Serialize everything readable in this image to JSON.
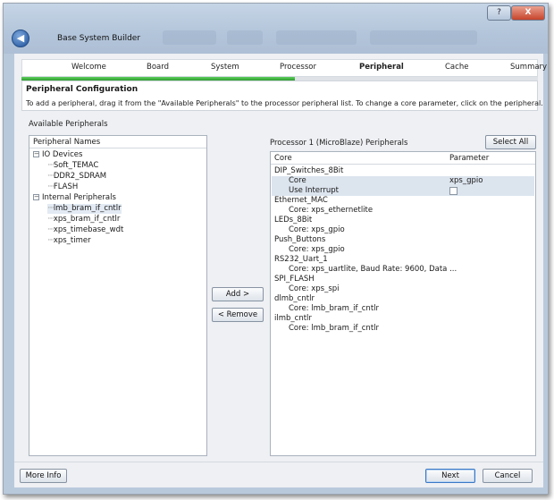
{
  "window": {
    "title": "Base System Builder",
    "help_label": "?",
    "close_label": "X",
    "back_label": "◀"
  },
  "steps": [
    {
      "label": "Welcome"
    },
    {
      "label": "Board"
    },
    {
      "label": "System"
    },
    {
      "label": "Processor"
    },
    {
      "label": "Peripheral"
    },
    {
      "label": "Cache"
    },
    {
      "label": "Summary"
    }
  ],
  "progress_fraction": 0.53,
  "header": {
    "title": "Peripheral Configuration",
    "description": "To add a peripheral, drag it from the \"Available Peripherals\" to the processor peripheral list. To change a core parameter, click on the peripheral."
  },
  "available": {
    "label": "Available Peripherals",
    "column": "Peripheral Names",
    "groups": [
      {
        "name": "IO Devices",
        "items": [
          "Soft_TEMAC",
          "DDR2_SDRAM",
          "FLASH"
        ]
      },
      {
        "name": "Internal Peripherals",
        "items": [
          "lmb_bram_if_cntlr",
          "xps_bram_if_cntlr",
          "xps_timebase_wdt",
          "xps_timer"
        ]
      }
    ]
  },
  "buttons": {
    "add": "Add >",
    "remove": "< Remove",
    "select_all": "Select All",
    "more_info": "More Info",
    "next": "Next",
    "cancel": "Cancel"
  },
  "processor": {
    "label": "Processor 1 (MicroBlaze) Peripherals",
    "col_core": "Core",
    "col_param": "Parameter",
    "rows": [
      {
        "text": "DIP_Switches_8Bit",
        "child": false
      },
      {
        "text": "Core",
        "child": true,
        "param": "xps_gpio",
        "selected": true
      },
      {
        "text": "Use Interrupt",
        "child": true,
        "checkbox": true,
        "selected": true
      },
      {
        "text": "Ethernet_MAC",
        "child": false
      },
      {
        "text": "Core: xps_ethernetlite",
        "child": true
      },
      {
        "text": "LEDs_8Bit",
        "child": false
      },
      {
        "text": "Core: xps_gpio",
        "child": true
      },
      {
        "text": "Push_Buttons",
        "child": false
      },
      {
        "text": "Core: xps_gpio",
        "child": true
      },
      {
        "text": "RS232_Uart_1",
        "child": false
      },
      {
        "text": "Core: xps_uartlite, Baud Rate: 9600, Data ...",
        "child": true
      },
      {
        "text": "SPI_FLASH",
        "child": false
      },
      {
        "text": "Core: xps_spi",
        "child": true
      },
      {
        "text": "dlmb_cntlr",
        "child": false
      },
      {
        "text": "Core: lmb_bram_if_cntlr",
        "child": true
      },
      {
        "text": "ilmb_cntlr",
        "child": false
      },
      {
        "text": "Core: lmb_bram_if_cntlr",
        "child": true
      }
    ]
  }
}
